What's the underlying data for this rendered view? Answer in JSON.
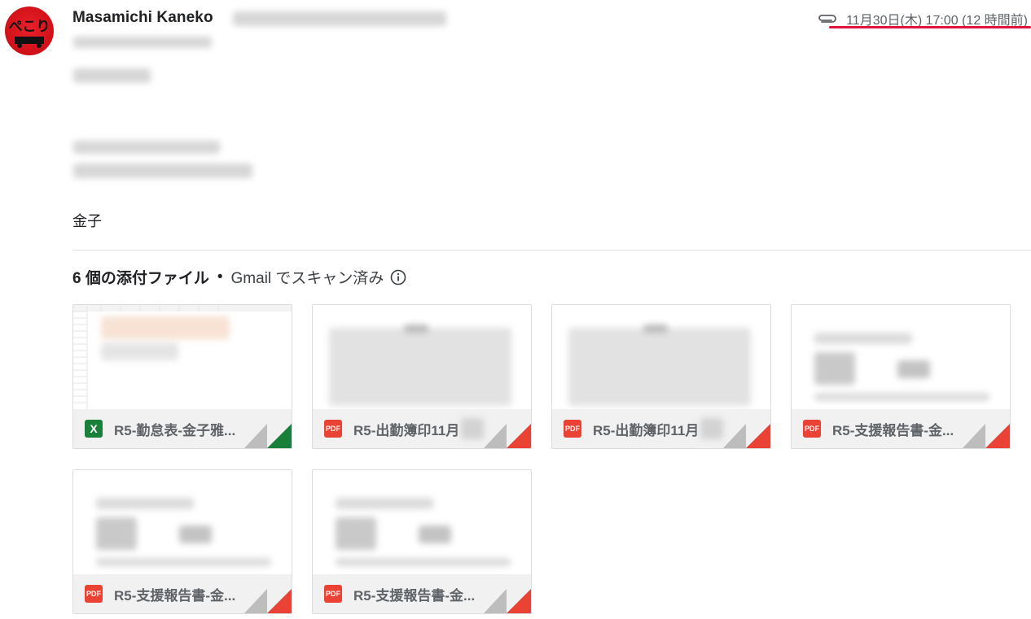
{
  "sender": {
    "name": "Masamichi Kaneko"
  },
  "header": {
    "datetime": "11月30日(木) 17:00 (12 時間前)",
    "attachment_icon": "paperclip-icon"
  },
  "body": {
    "signoff": "金子"
  },
  "attachments": {
    "count_label": "6 個の添付ファイル",
    "separator": "•",
    "scan_label": "Gmail でスキャン済み",
    "items": [
      {
        "type_label": "X",
        "kind": "xlsx",
        "name": "R5-勤怠表-金子雅...",
        "corner_color": "#188038"
      },
      {
        "type_label": "PDF",
        "kind": "pdf",
        "name": "R5-出勤簿印11月",
        "corner_color": "#ea4335"
      },
      {
        "type_label": "PDF",
        "kind": "pdf",
        "name": "R5-出勤簿印11月",
        "corner_color": "#ea4335"
      },
      {
        "type_label": "PDF",
        "kind": "pdf",
        "name": "R5-支援報告書-金...",
        "corner_color": "#ea4335"
      },
      {
        "type_label": "PDF",
        "kind": "pdf",
        "name": "R5-支援報告書-金...",
        "corner_color": "#ea4335"
      },
      {
        "type_label": "PDF",
        "kind": "pdf",
        "name": "R5-支援報告書-金...",
        "corner_color": "#ea4335"
      }
    ]
  },
  "colors": {
    "underline": "#e0143c",
    "pdf": "#ea4335",
    "xlsx": "#188038"
  }
}
